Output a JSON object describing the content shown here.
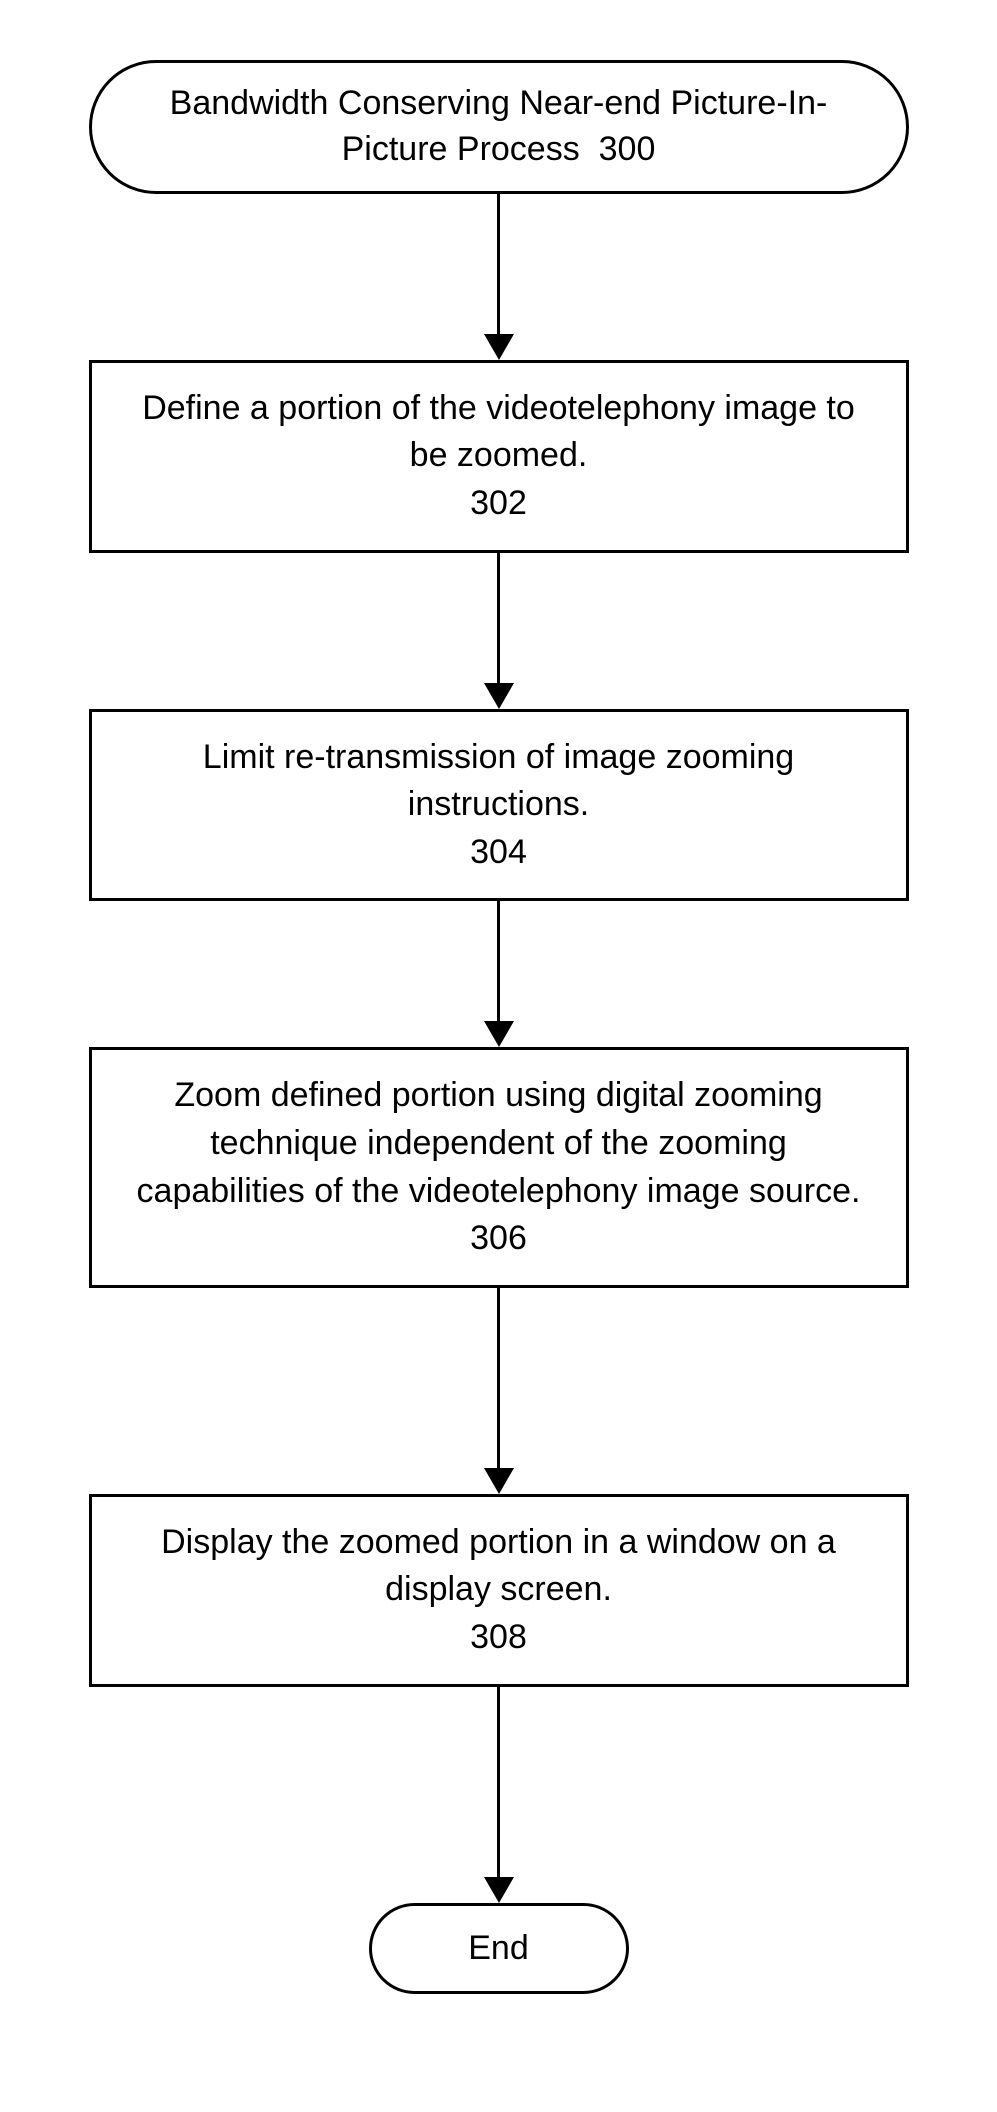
{
  "start": {
    "title": "Bandwidth Conserving Near-end Picture-In-Picture Process",
    "ref": "300"
  },
  "steps": [
    {
      "text": "Define a portion of the videotelephony image to be zoomed.",
      "ref": "302"
    },
    {
      "text": "Limit re-transmission of image zooming instructions.",
      "ref": "304"
    },
    {
      "text": "Zoom defined portion using digital zooming technique independent of the zooming capabilities of the videotelephony image source.",
      "ref": "306"
    },
    {
      "text": "Display the zoomed portion in a window on a display screen.",
      "ref": "308"
    }
  ],
  "end": {
    "label": "End"
  },
  "arrow_heights": [
    140,
    130,
    120,
    180,
    190
  ]
}
